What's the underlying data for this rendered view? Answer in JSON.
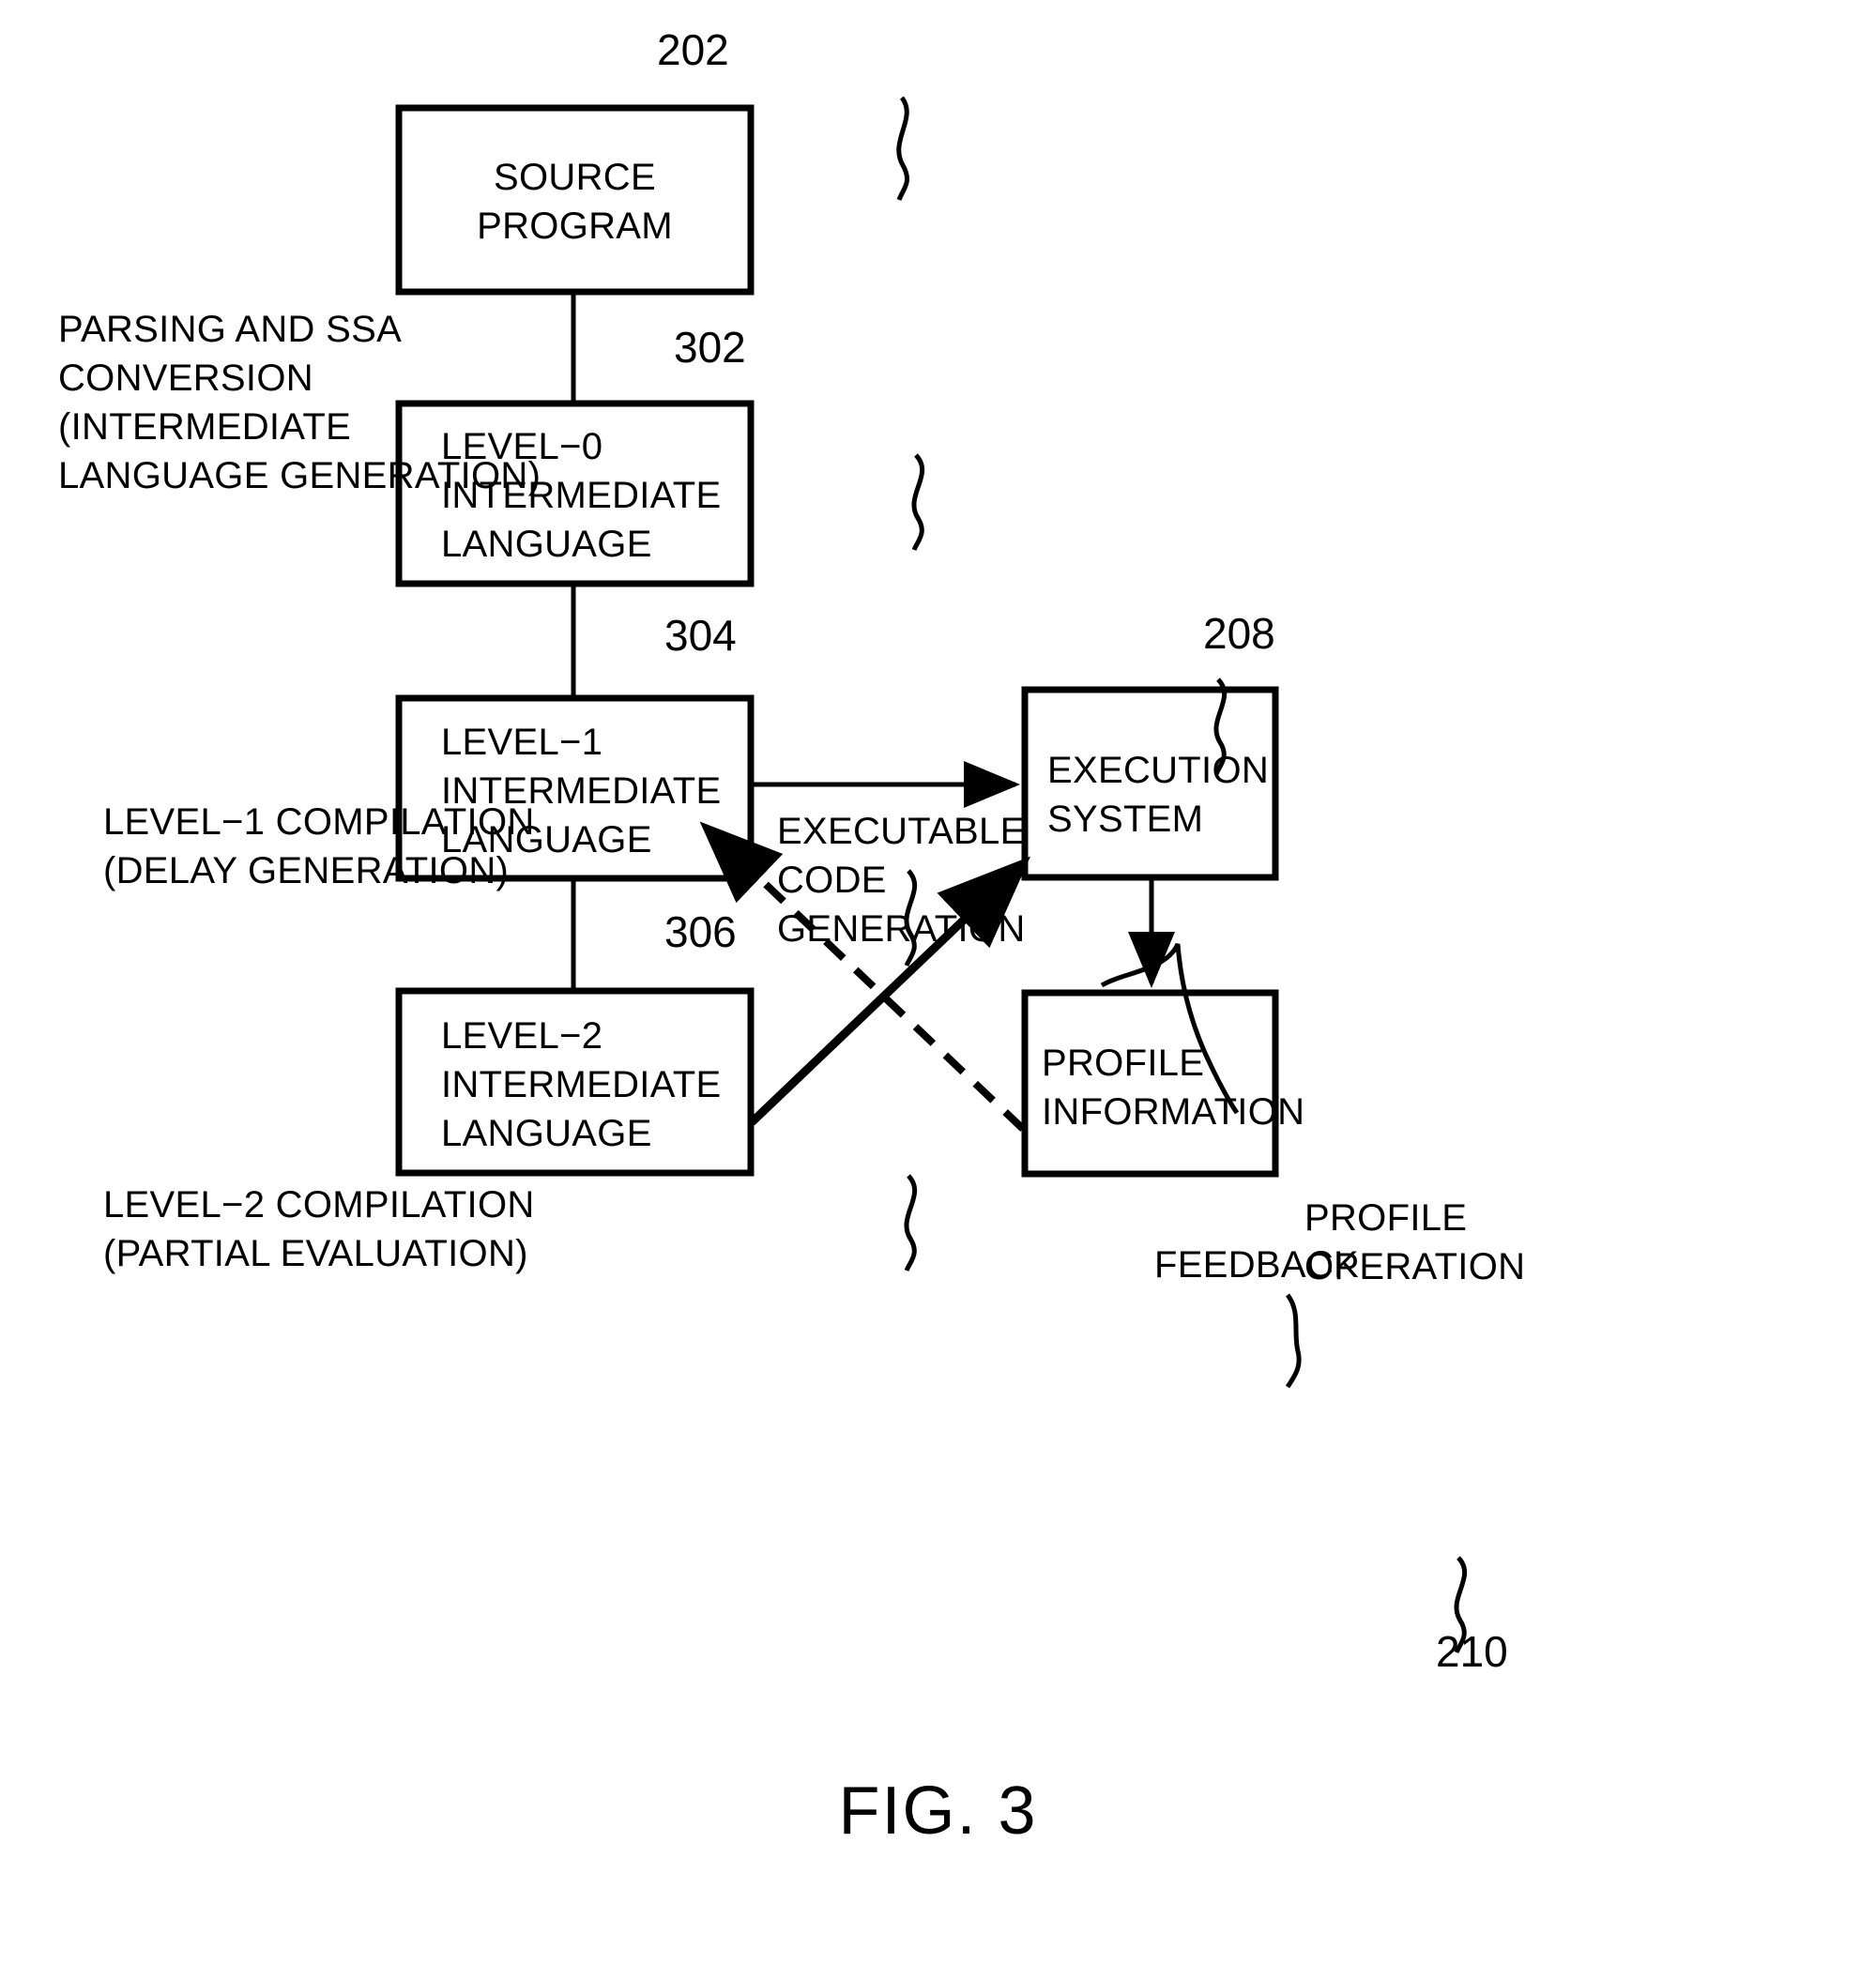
{
  "figure": {
    "caption": "FIG. 3",
    "boxes": [
      {
        "id": "source-program",
        "label": "SOURCE\nPROGRAM",
        "ref": "202",
        "align": "center"
      },
      {
        "id": "level-0-il",
        "label": "LEVEL−0\nINTERMEDIATE\nLANGUAGE",
        "ref": "302",
        "align": "left"
      },
      {
        "id": "level-1-il",
        "label": "LEVEL−1\nINTERMEDIATE\nLANGUAGE",
        "ref": "304",
        "align": "left"
      },
      {
        "id": "level-2-il",
        "label": "LEVEL−2\nINTERMEDIATE\nLANGUAGE",
        "ref": "306",
        "align": "left"
      },
      {
        "id": "execution-system",
        "label": "EXECUTION\nSYSTEM",
        "ref": "208",
        "align": "left"
      },
      {
        "id": "profile-information",
        "label": "PROFILE\nINFORMATION",
        "ref": "210",
        "align": "left"
      }
    ],
    "process_labels": [
      {
        "id": "parsing-ssa",
        "text": "PARSING AND SSA\nCONVERSION\n(INTERMEDIATE\nLANGUAGE GENERATION)"
      },
      {
        "id": "level-1-compilation",
        "text": "LEVEL−1 COMPILATION\n(DELAY GENERATION)"
      },
      {
        "id": "level-2-compilation",
        "text": "LEVEL−2 COMPILATION\n(PARTIAL EVALUATION)"
      },
      {
        "id": "executable-code-gen",
        "text": "EXECUTABLE\nCODE\nGENERATION"
      },
      {
        "id": "feedback",
        "text": "FEEDBACK"
      },
      {
        "id": "profile-operation",
        "text": "PROFILE\nOPERATION"
      }
    ],
    "colors": {
      "stroke": "#000000",
      "background": "#ffffff"
    }
  }
}
